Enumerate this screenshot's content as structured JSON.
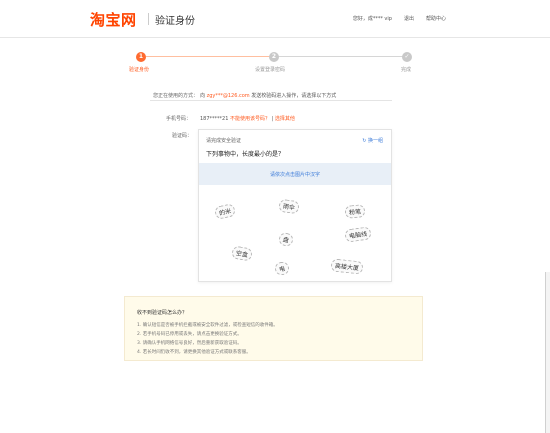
{
  "header": {
    "logo": "淘宝网",
    "page_title": "验证身份",
    "user_links": [
      "您好，成**** vip",
      "退出",
      "帮助中心"
    ]
  },
  "steps": [
    {
      "number": "1",
      "label": "验证身份"
    },
    {
      "number": "2",
      "label": "设置登录密码"
    },
    {
      "number": "✓",
      "label": "完成"
    }
  ],
  "form": {
    "method_label": "您正在使用的方式：",
    "method_prefix": "向",
    "method_email": "zgy***@126.com",
    "method_suffix": "发送校验码进入操作，请选择以下方式",
    "phone_label": "手机号码：",
    "phone_value": "187*****21",
    "phone_change": "不能使用该号码？",
    "phone_other": "选择其他",
    "captcha_label": "验证码："
  },
  "captcha": {
    "title": "请完成安全验证",
    "refresh": "↻ 换一组",
    "question": "下列事物中，长度最小的是？",
    "instruction": "请依次点击图片中汉字",
    "glyphs": [
      {
        "id": "g1",
        "text": "的米"
      },
      {
        "id": "g2",
        "text": "雨伞"
      },
      {
        "id": "g3",
        "text": "粉笔"
      },
      {
        "id": "g4",
        "text": "盘"
      },
      {
        "id": "g5",
        "text": "电脑线"
      },
      {
        "id": "g6",
        "text": "空盒"
      },
      {
        "id": "g7",
        "text": "电"
      },
      {
        "id": "g8",
        "text": "高楼大厦"
      }
    ]
  },
  "help": {
    "title": "收不到验证码怎么办？",
    "items": [
      "1. 确认短信是否被手机拦截或被安全软件过滤，或检查短信的收件箱。",
      "2. 若手机号码已停用或丢失，请点击更换验证方式。",
      "3. 请确认手机网络信号良好，然后重新获取验证码。",
      "4. 若长时间仍收不到，请更换其他验证方式或联系客服。"
    ]
  }
}
